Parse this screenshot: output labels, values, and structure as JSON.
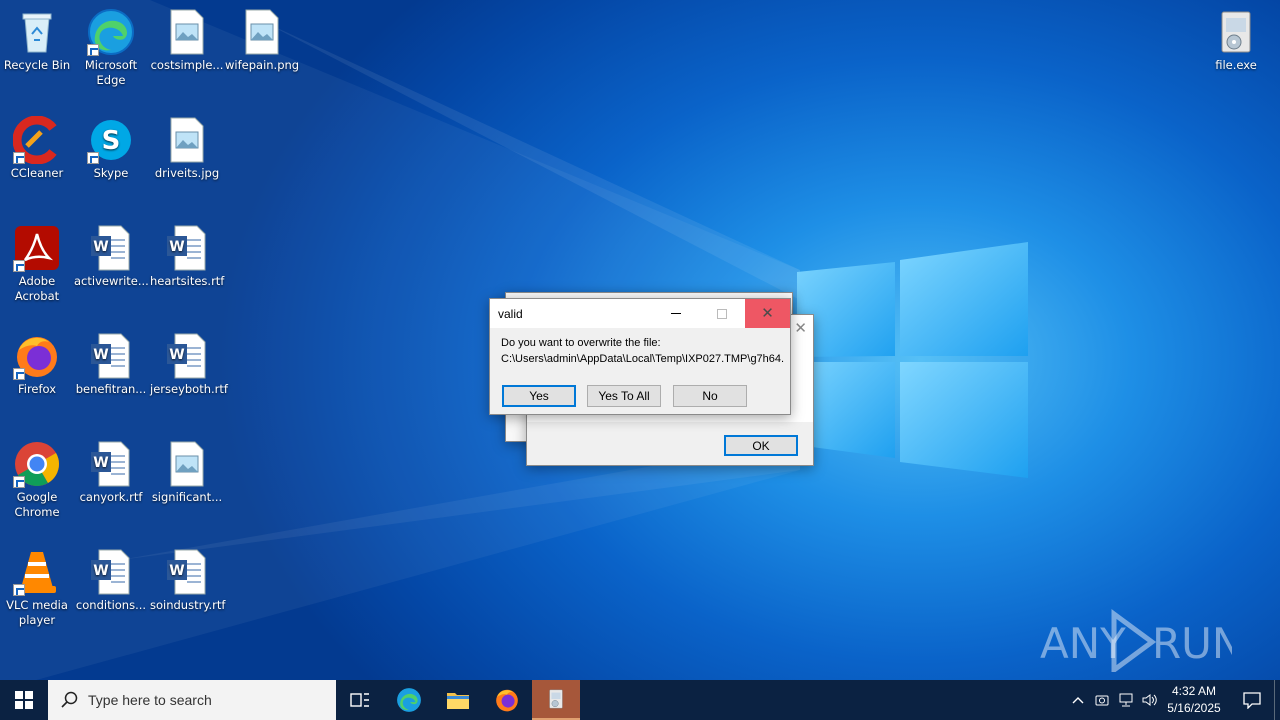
{
  "desktop": {
    "icons": [
      {
        "label": "Recycle Bin",
        "icon": "recycle-bin-icon"
      },
      {
        "label": "Microsoft Edge",
        "icon": "edge-icon"
      },
      {
        "label": "costsimple...",
        "icon": "image-file-icon"
      },
      {
        "label": "wifepain.png",
        "icon": "image-file-icon"
      },
      {
        "label": "CCleaner",
        "icon": "ccleaner-icon"
      },
      {
        "label": "Skype",
        "icon": "skype-icon"
      },
      {
        "label": "driveits.jpg",
        "icon": "image-file-icon"
      },
      {
        "label": "Adobe Acrobat",
        "icon": "acrobat-icon"
      },
      {
        "label": "activewrite...",
        "icon": "word-file-icon"
      },
      {
        "label": "heartsites.rtf",
        "icon": "word-file-icon"
      },
      {
        "label": "Firefox",
        "icon": "firefox-icon"
      },
      {
        "label": "benefitran...",
        "icon": "word-file-icon"
      },
      {
        "label": "jerseyboth.rtf",
        "icon": "word-file-icon"
      },
      {
        "label": "Google Chrome",
        "icon": "chrome-icon"
      },
      {
        "label": "canyork.rtf",
        "icon": "word-file-icon"
      },
      {
        "label": "significant...",
        "icon": "image-file-icon"
      },
      {
        "label": "VLC media player",
        "icon": "vlc-icon"
      },
      {
        "label": "conditions...",
        "icon": "word-file-icon"
      },
      {
        "label": "soindustry.rtf",
        "icon": "word-file-icon"
      },
      {
        "label": "file.exe",
        "icon": "installer-icon"
      }
    ]
  },
  "dialog": {
    "title": "valid",
    "message_line1": "Do you want to overwrite the file:",
    "message_line2": "C:\\Users\\admin\\AppData\\Local\\Temp\\IXP027.TMP\\g7h64.",
    "yes_label": "Yes",
    "yes_to_all_label": "Yes To All",
    "no_label": "No"
  },
  "back_dialog": {
    "ok_label": "OK"
  },
  "taskbar": {
    "search_placeholder": "Type here to search",
    "time": "4:32 AM",
    "date": "5/16/2025"
  },
  "watermark": {
    "text_left": "ANY",
    "text_right": "RUN"
  }
}
